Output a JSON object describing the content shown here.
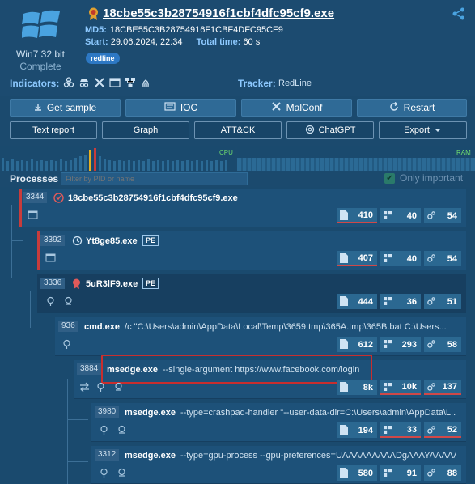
{
  "header": {
    "os_label": "Win7 32 bit",
    "status": "Complete",
    "sample_name": "18cbe55c3b28754916f1cbf4dfc95cf9.exe",
    "md5_label": "MD5:",
    "md5_value": "18CBE55C3B28754916F1CBF4DFC95CF9",
    "start_label": "Start:",
    "start_value": "29.06.2024, 22:34",
    "total_label": "Total time:",
    "total_value": "60 s",
    "tag": "redline",
    "indicators_label": "Indicators:",
    "tracker_label": "Tracker:",
    "tracker_value": "RedLine"
  },
  "buttons_row1": [
    "Get sample",
    "IOC",
    "MalConf",
    "Restart"
  ],
  "buttons_row2": [
    "Text report",
    "Graph",
    "ATT&CK",
    "ChatGPT",
    "Export"
  ],
  "monitor": {
    "cpu_label": "CPU",
    "ram_label": "RAM"
  },
  "processes_panel": {
    "title": "Processes",
    "filter_placeholder": "Filter by PID or name",
    "only_important_label": "Only important",
    "only_important_checked": true
  },
  "processes": [
    {
      "pid": "3344",
      "name": "18cbe55c3b28754916f1cbf4dfc95cf9.exe",
      "cmd": "",
      "pe": "",
      "files": "410",
      "reg": "40",
      "mod": "54",
      "flagged": true
    },
    {
      "pid": "3392",
      "name": "Yt8ge85.exe",
      "cmd": "",
      "pe": "PE",
      "files": "407",
      "reg": "40",
      "mod": "54",
      "flagged": true
    },
    {
      "pid": "3336",
      "name": "5uR3lF9.exe",
      "cmd": "",
      "pe": "PE",
      "files": "444",
      "reg": "36",
      "mod": "51",
      "flagged": false
    },
    {
      "pid": "936",
      "name": "cmd.exe",
      "cmd": "/c \"C:\\Users\\admin\\AppData\\Local\\Temp\\3659.tmp\\365A.tmp\\365B.bat C:\\Users...",
      "pe": "",
      "files": "612",
      "reg": "293",
      "mod": "58",
      "flagged": false
    },
    {
      "pid": "3884",
      "name": "msedge.exe",
      "cmd": "--single-argument https://www.facebook.com/login",
      "pe": "",
      "files": "8k",
      "reg": "10k",
      "mod": "137",
      "flagged": false
    },
    {
      "pid": "3980",
      "name": "msedge.exe",
      "cmd": "--type=crashpad-handler \"--user-data-dir=C:\\Users\\admin\\AppData\\L...",
      "pe": "",
      "files": "194",
      "reg": "33",
      "mod": "52",
      "flagged": false
    },
    {
      "pid": "3312",
      "name": "msedge.exe",
      "cmd": "--type=gpu-process --gpu-preferences=UAAAAAAAAADgAAAYAAAAA...",
      "pe": "",
      "files": "580",
      "reg": "91",
      "mod": "88",
      "flagged": false
    }
  ],
  "colors": {
    "accent": "#8dc9ff",
    "danger": "#c83c3c",
    "bg": "#1b4a6e"
  }
}
